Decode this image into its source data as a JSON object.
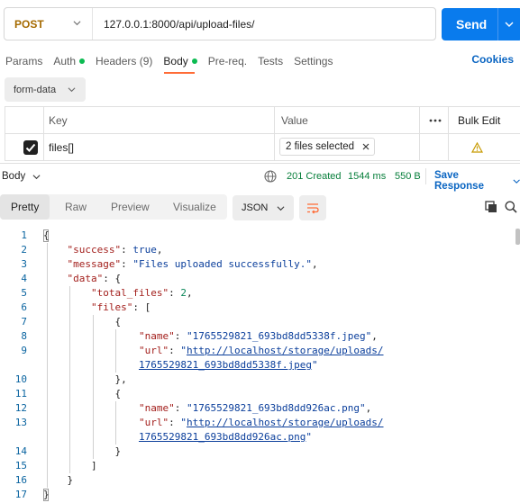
{
  "request": {
    "method": "POST",
    "url": "127.0.0.1:8000/api/upload-files/",
    "send_label": "Send"
  },
  "tabs": [
    {
      "label": "Params"
    },
    {
      "label": "Auth"
    },
    {
      "label": "Headers (9)"
    },
    {
      "label": "Body"
    },
    {
      "label": "Pre-req."
    },
    {
      "label": "Tests"
    },
    {
      "label": "Settings"
    }
  ],
  "cookies_label": "Cookies",
  "body_type": "form-data",
  "table": {
    "headers": {
      "key": "Key",
      "value": "Value",
      "bulk": "Bulk Edit"
    },
    "rows": [
      {
        "key": "files[]",
        "value": "2 files selected"
      }
    ]
  },
  "response": {
    "body_label": "Body",
    "status": "201 Created",
    "time": "1544 ms",
    "size": "550 B",
    "save_label": "Save Response",
    "tabs": [
      {
        "label": "Pretty"
      },
      {
        "label": "Raw"
      },
      {
        "label": "Preview"
      },
      {
        "label": "Visualize"
      }
    ],
    "format": "JSON"
  },
  "code": {
    "line_numbers": [
      "1",
      "2",
      "3",
      "4",
      "5",
      "6",
      "7",
      "8",
      "9",
      "",
      "10",
      "11",
      "12",
      "13",
      "",
      "14",
      "15",
      "16",
      "17"
    ],
    "success_key": "\"success\"",
    "success_val": "true",
    "message_key": "\"message\"",
    "message_val": "\"Files uploaded successfully.\"",
    "data_key": "\"data\"",
    "total_files_key": "\"total_files\"",
    "total_files_val": "2",
    "files_key": "\"files\"",
    "file1_name": "\"1765529821_693bd8dd5338f.jpeg\"",
    "file1_url_a": "http://localhost/storage/uploads/",
    "file1_url_b": "1765529821_693bd8dd5338f.jpeg",
    "file2_name": "\"1765529821_693bd8dd926ac.png\"",
    "file2_url_a": "http://localhost/storage/uploads/",
    "file2_url_b": "1765529821_693bd8dd926ac.png",
    "name_key": "\"name\"",
    "url_key": "\"url\""
  },
  "colors": {
    "accent": "#097bed",
    "method": "#a56a00",
    "status_ok": "#067e3a",
    "active_tab": "#ff6c37"
  }
}
